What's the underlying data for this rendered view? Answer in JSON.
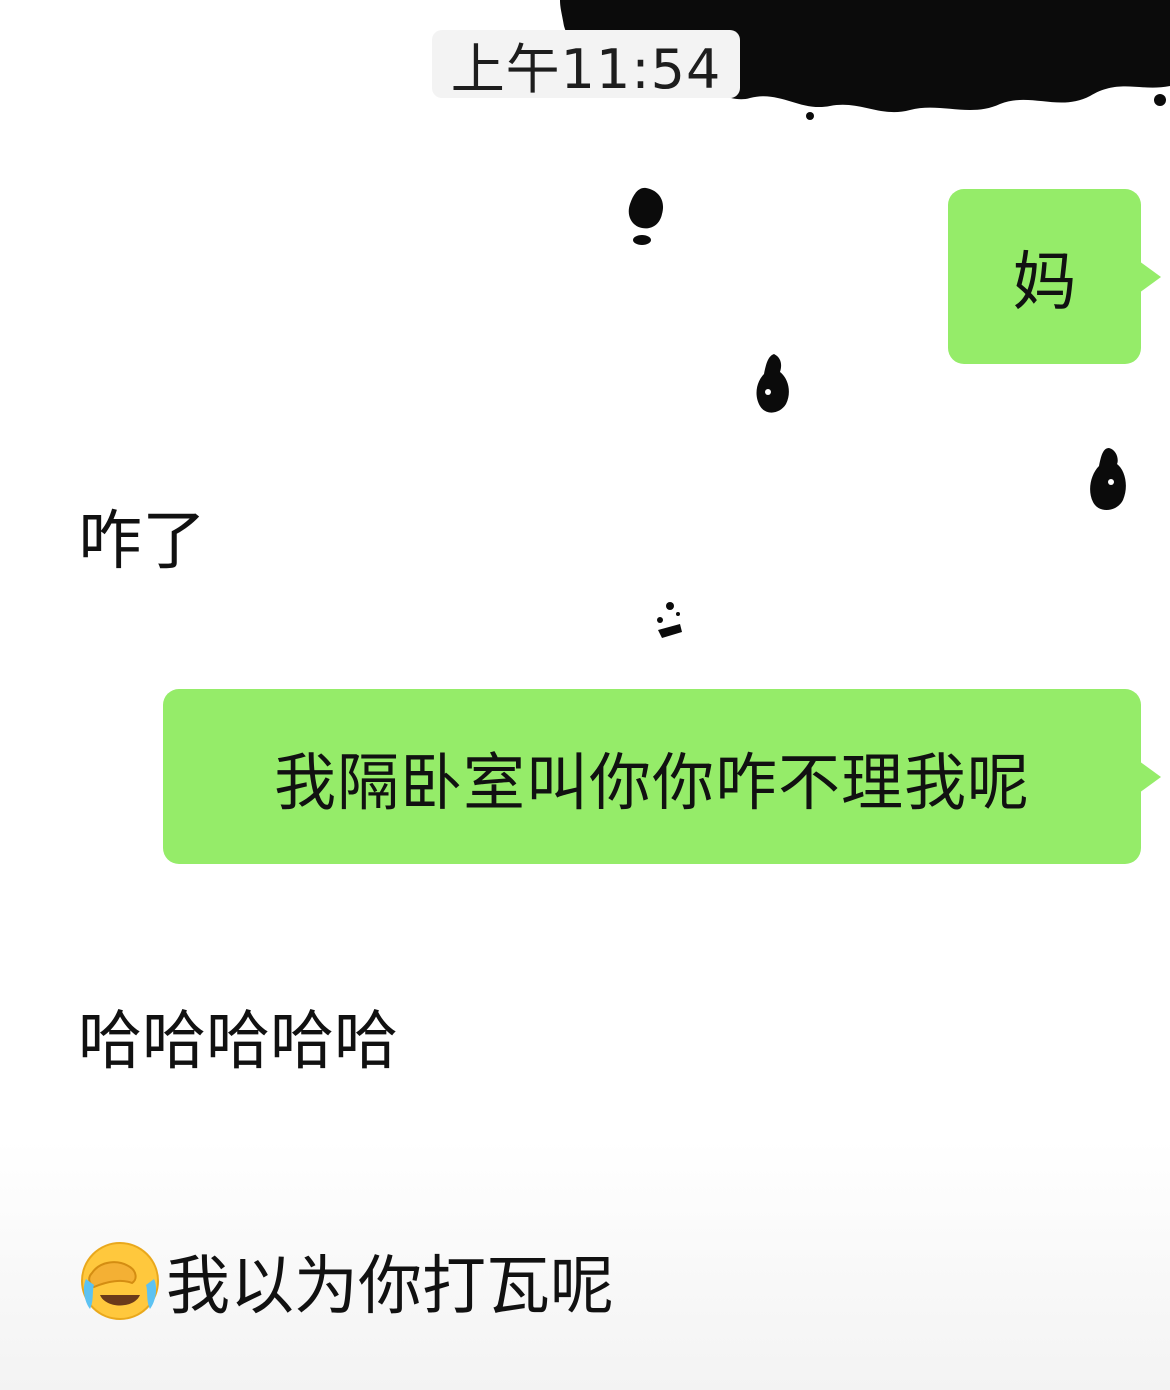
{
  "chat": {
    "timestamp": "上午11:54",
    "messages": [
      {
        "sender": "me",
        "text": "妈"
      },
      {
        "sender": "other",
        "text": "咋了"
      },
      {
        "sender": "me",
        "text": "我隔卧室叫你你咋不理我呢"
      },
      {
        "sender": "other",
        "text": "哈哈哈哈哈"
      },
      {
        "sender": "other",
        "emoji": "face-with-tears-of-joy-covering-eyes",
        "text": "我以为你打瓦呢"
      }
    ]
  },
  "colors": {
    "sent_bubble": "#95ec69",
    "background": "#ffffff",
    "timestamp_bg": "#f3f3f3",
    "text": "#111111",
    "ink": "#0a0a0a"
  }
}
